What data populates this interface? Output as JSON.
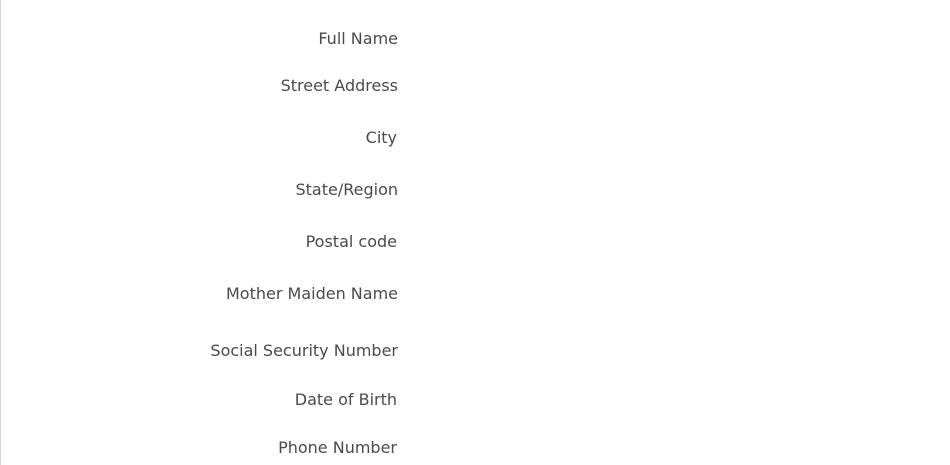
{
  "form": {
    "fields": [
      {
        "label": "Full Name",
        "value": ""
      },
      {
        "label": "Street Address",
        "value": ""
      },
      {
        "label": "City",
        "value": ""
      },
      {
        "label": "State/Region",
        "value": ""
      },
      {
        "label": "Postal code",
        "value": ""
      },
      {
        "label": "Mother Maiden Name",
        "value": ""
      },
      {
        "label": "Social Security Number",
        "value": ""
      },
      {
        "label": "Date of Birth",
        "value": ""
      },
      {
        "label": "Phone Number",
        "value": ""
      }
    ]
  }
}
